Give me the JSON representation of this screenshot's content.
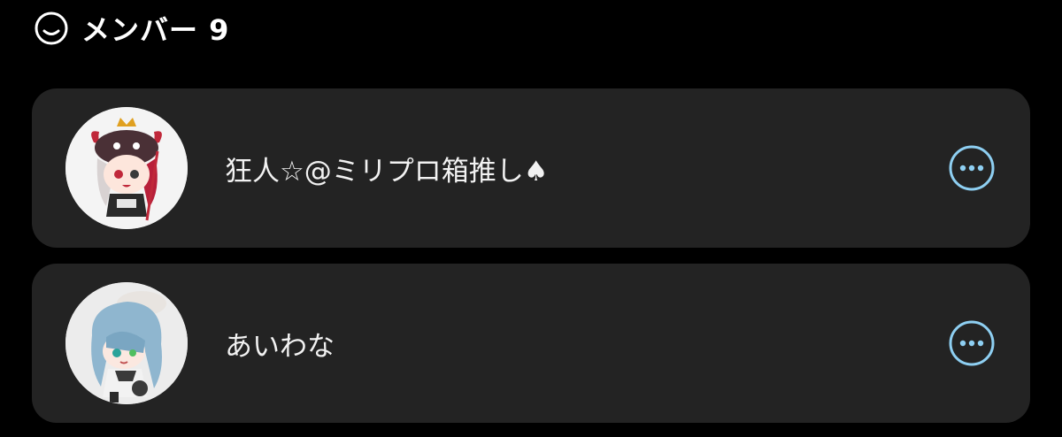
{
  "header": {
    "icon": "smile-icon",
    "title": "メンバー 9"
  },
  "members": [
    {
      "name": "狂人☆@ミリプロ箱推し♠",
      "avatar": "avatar-chibi-red-hair",
      "more_icon": "more-options-icon"
    },
    {
      "name": "あいわな",
      "avatar": "avatar-chibi-blue-hair",
      "more_icon": "more-options-icon"
    }
  ],
  "colors": {
    "background": "#000000",
    "card": "#232323",
    "text": "#f2f2f2",
    "accent": "#8ecff2"
  }
}
